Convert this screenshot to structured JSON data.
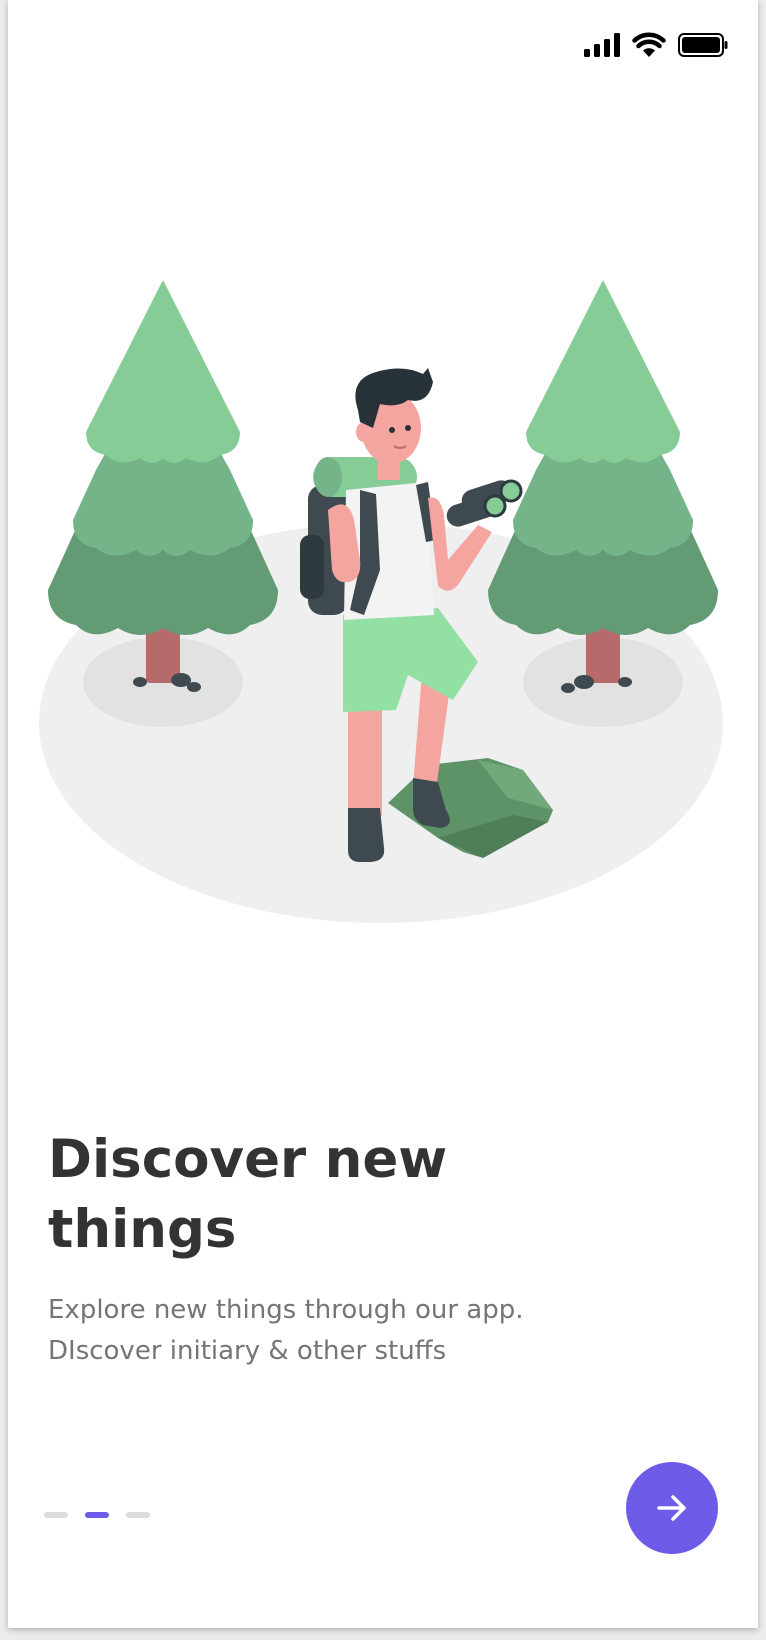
{
  "status_bar": {
    "signal_icon": "cellular-signal-icon",
    "wifi_icon": "wifi-icon",
    "battery_icon": "battery-icon"
  },
  "illustration": {
    "name": "hiker-with-binoculars-illustration"
  },
  "onboarding": {
    "title_line1": "Discover new",
    "title_line2": "things",
    "subtitle_line1": "Explore new things through our app.",
    "subtitle_line2": "DIscover initiary & other stuffs",
    "pager": {
      "total": 3,
      "active_index": 1
    },
    "next_button_icon": "arrow-right-icon"
  },
  "colors": {
    "accent": "#6c5ce7",
    "title": "#333333",
    "subtitle": "#757575",
    "tree_light": "#86cc97",
    "tree_mid": "#74b488",
    "tree_dark": "#639b74",
    "ground": "#efefef"
  }
}
